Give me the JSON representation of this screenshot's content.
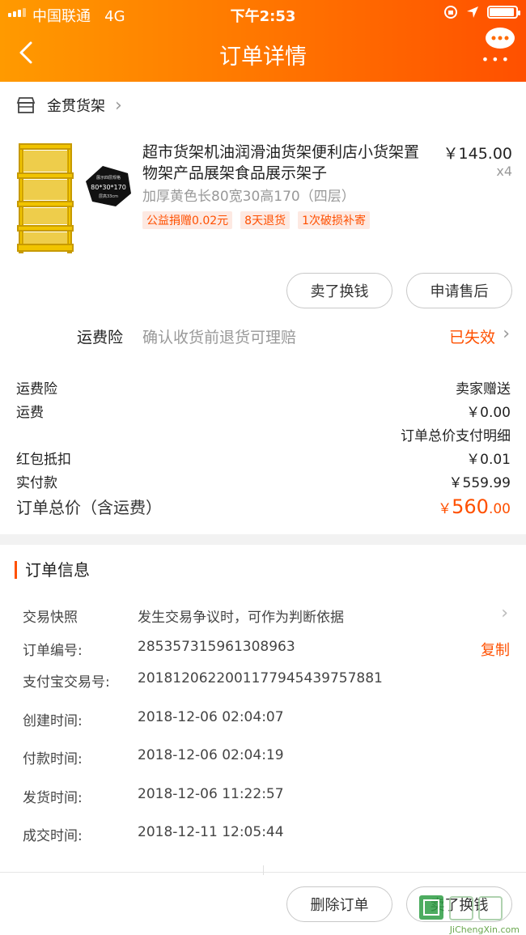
{
  "status": {
    "carrier": "中国联通",
    "network": "4G",
    "time": "下午2:53"
  },
  "header": {
    "title": "订单详情"
  },
  "shop": {
    "name": "金贯货架"
  },
  "product": {
    "title": "超市货架机油润滑油货架便利店小货架置物架产品展架食品展示架子",
    "price": "￥145.00",
    "qty": "x4",
    "spec": "加厚黄色长80宽30高170（四层）",
    "tags": [
      "公益捐赠0.02元",
      "8天退货",
      "1次破损补寄"
    ],
    "badge_lines": [
      "展示四层规格",
      "80*30*170",
      "层高33cm"
    ]
  },
  "actions": {
    "sell": "卖了换钱",
    "aftersale": "申请售后"
  },
  "insurance": {
    "label": "运费险",
    "desc": "确认收货前退货可理赔",
    "status": "已失效"
  },
  "fees": {
    "ins_label": "运费险",
    "ins_value": "卖家赠送",
    "ship_label": "运费",
    "ship_value": "￥0.00",
    "detail_link": "订单总价支付明细",
    "red_label": "红包抵扣",
    "red_value": "￥0.01",
    "paid_label": "实付款",
    "paid_value": "￥559.99",
    "total_label": "订单总价（含运费）",
    "total_currency": "￥",
    "total_int": "560",
    "total_dec": ".00"
  },
  "order_info": {
    "heading": "订单信息",
    "snapshot_label": "交易快照",
    "snapshot_value": "发生交易争议时，可作为判断依据",
    "order_no_label": "订单编号:",
    "order_no": "285357315961308963",
    "copy": "复制",
    "alipay_label": "支付宝交易号:",
    "alipay_no": "2018120622001177945439757881",
    "created_label": "创建时间:",
    "created": "2018-12-06 02:04:07",
    "paid_label": "付款时间:",
    "paid": "2018-12-06 02:04:19",
    "shipped_label": "发货时间:",
    "shipped": "2018-12-06 11:22:57",
    "done_label": "成交时间:",
    "done": "2018-12-11 12:05:44"
  },
  "footer": {
    "delete": "删除订单",
    "sell": "卖了换钱"
  },
  "watermark": {
    "text": "JiChengXin.com"
  },
  "colors": {
    "accent": "#ff5000",
    "header_start": "#ff9a00",
    "header_end": "#ff5000"
  }
}
